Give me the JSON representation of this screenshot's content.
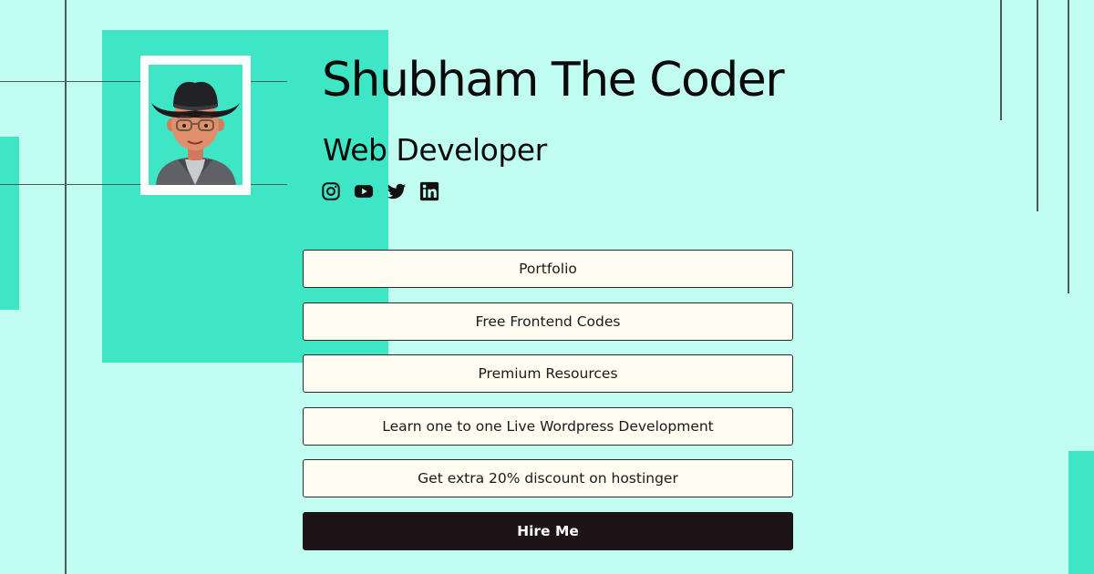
{
  "profile": {
    "name": "Shubham The Coder",
    "role": "Web Developer",
    "avatar_icon": "cartoon-avatar-cowboy-hat"
  },
  "socials": [
    {
      "name": "Instagram",
      "icon": "instagram-icon"
    },
    {
      "name": "YouTube",
      "icon": "youtube-icon"
    },
    {
      "name": "Twitter",
      "icon": "twitter-icon"
    },
    {
      "name": "LinkedIn",
      "icon": "linkedin-icon"
    }
  ],
  "links": [
    {
      "label": "Portfolio"
    },
    {
      "label": "Free Frontend Codes"
    },
    {
      "label": "Premium Resources"
    },
    {
      "label": "Learn one to one Live Wordpress Development"
    },
    {
      "label": "Get extra 20% discount on hostinger"
    },
    {
      "label": "Hire Me"
    }
  ],
  "colors": {
    "background": "#c0fdf0",
    "accent": "#3ee6c6",
    "button_bg": "#fffcf2",
    "primary_button_bg": "#1c1416"
  }
}
